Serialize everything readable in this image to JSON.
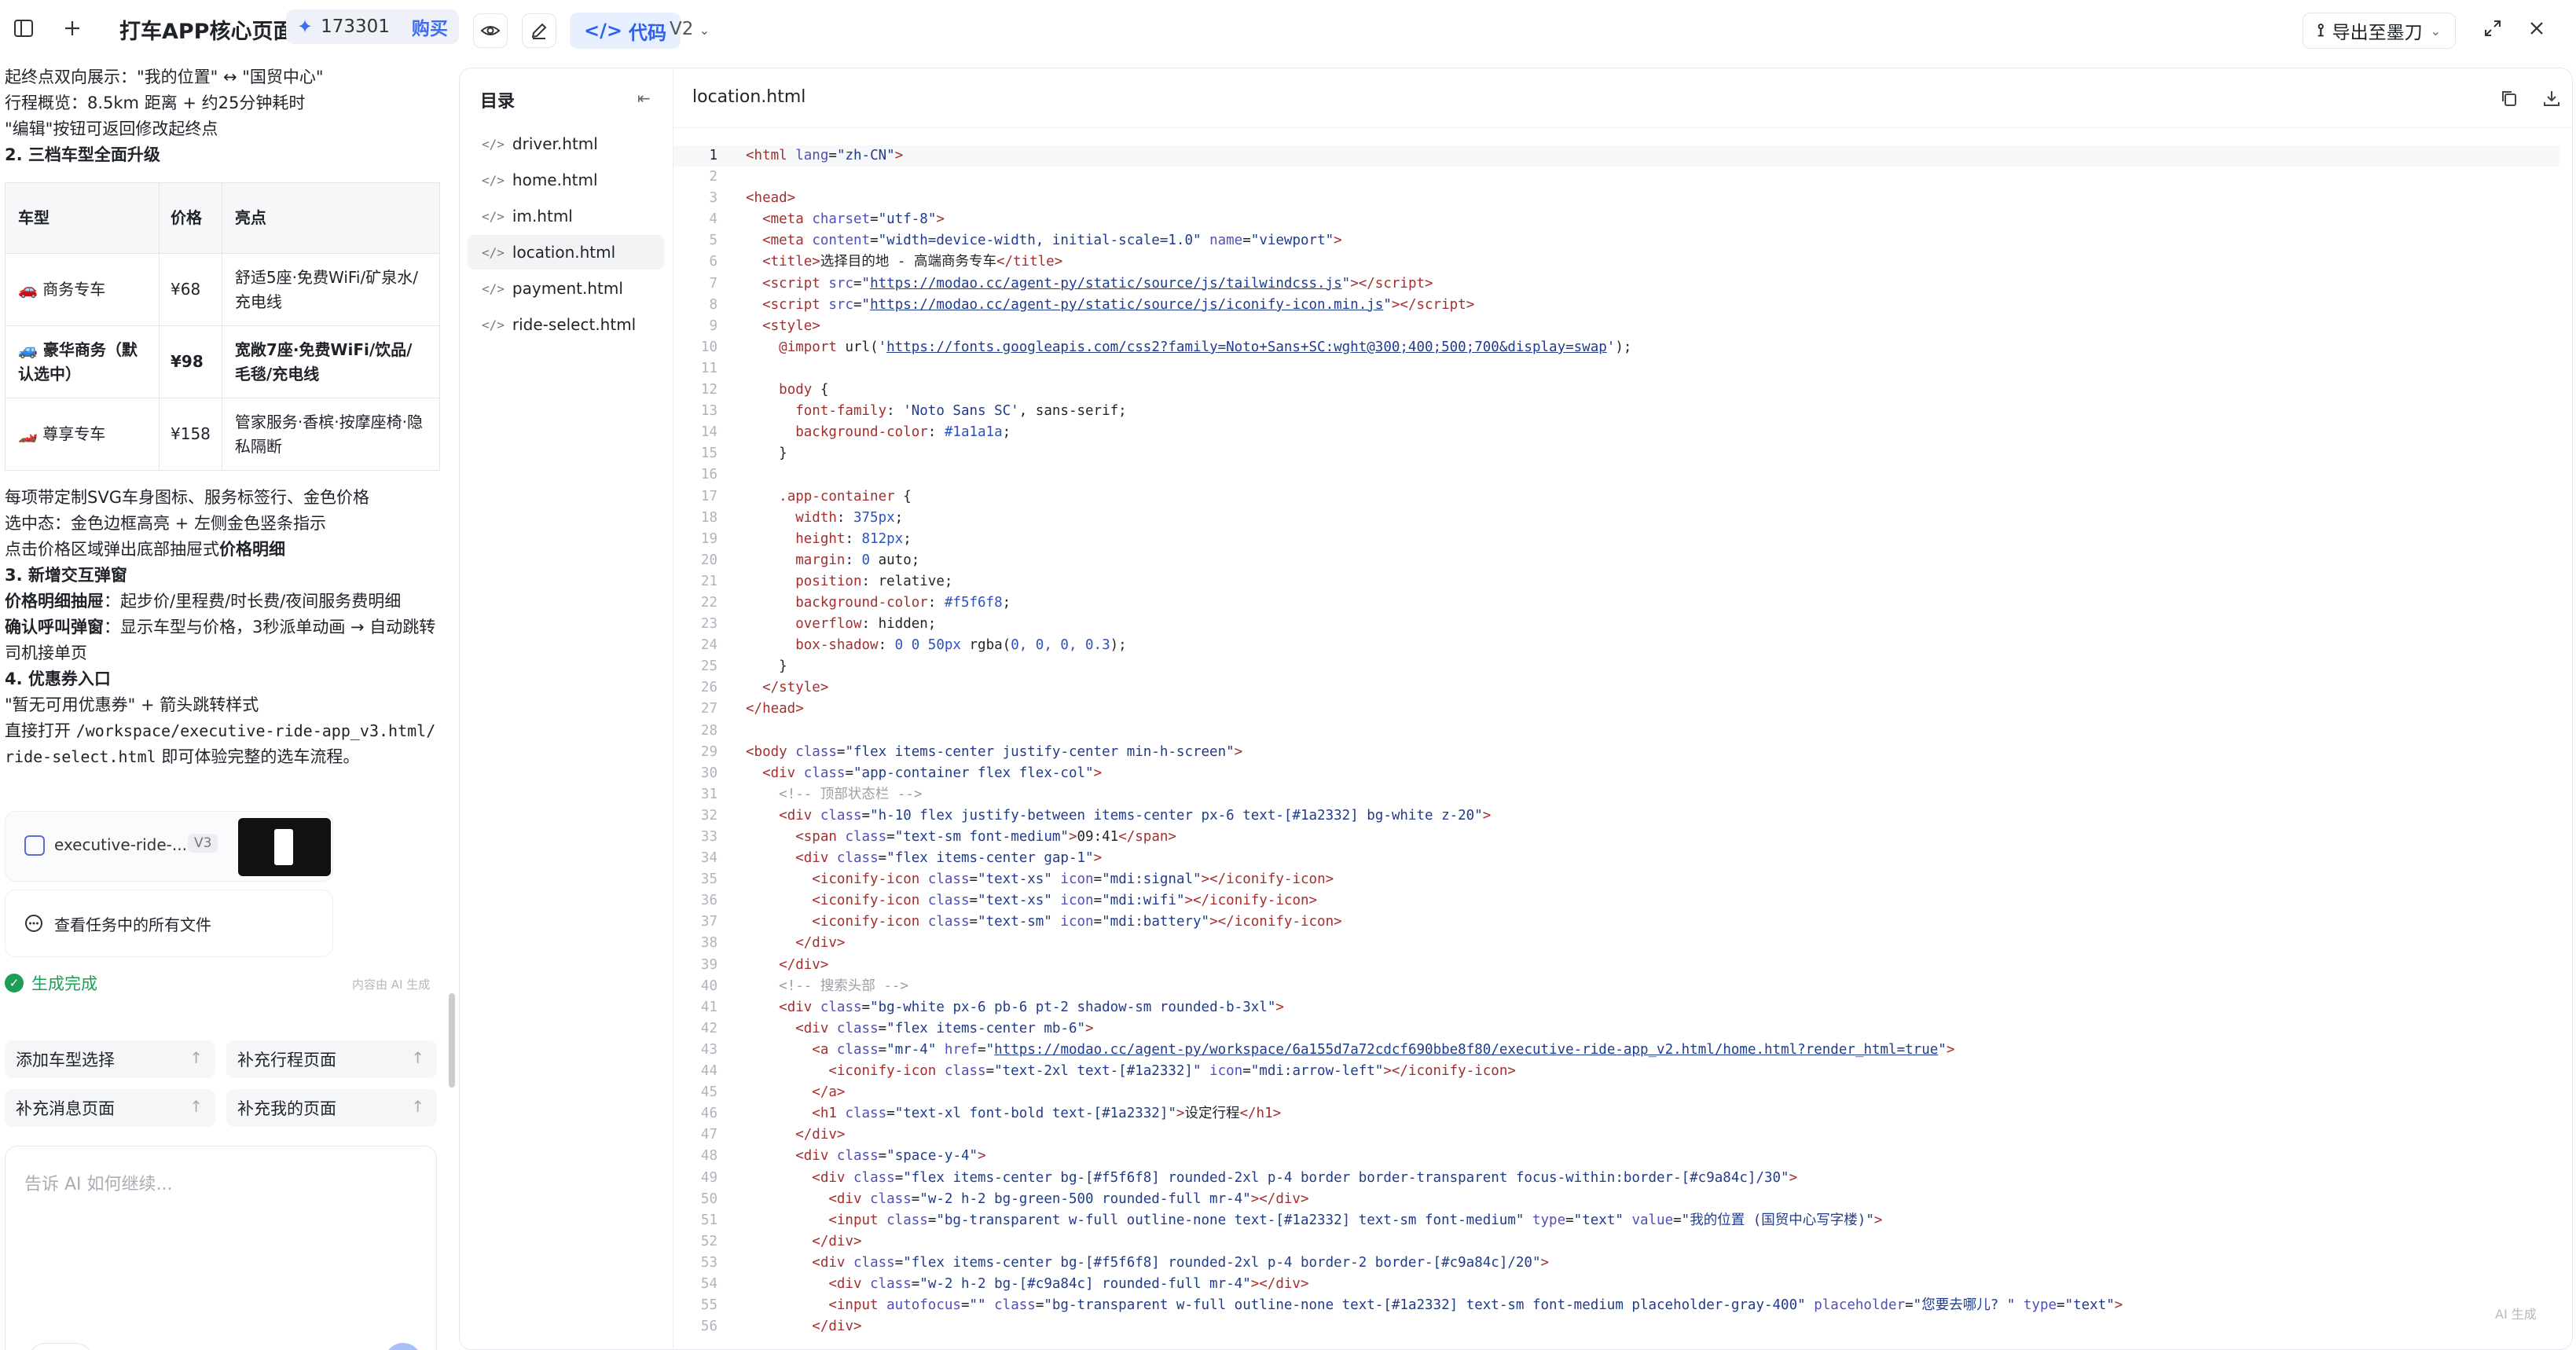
{
  "topbar": {
    "title": "打车APP核心页面...",
    "credits": "173301",
    "buy": "购买",
    "code_tab": "代码",
    "version": "V2",
    "export": "导出至墨刀"
  },
  "chat": {
    "lines_top": [
      "起终点双向展示：\"我的位置\" ↔ \"国贸中心\"",
      "行程概览：8.5km 距离 + 约25分钟耗时",
      "\"编辑\"按钮可返回修改起终点"
    ],
    "h2": "2. 三档车型全面升级",
    "table": {
      "headers": [
        "车型",
        "价格",
        "亮点"
      ],
      "rows": [
        {
          "type": "🚗 商务专车",
          "price": "¥68",
          "highlight": "舒适5座·免费WiFi/矿泉水/充电线"
        },
        {
          "type": "🚙 豪华商务（默认选中）",
          "price": "¥98",
          "highlight": "宽敞7座·免费WiFi/饮品/毛毯/充电线"
        },
        {
          "type": "🏎️ 尊享专车",
          "price": "¥158",
          "highlight": "管家服务·香槟·按摩座椅·隐私隔断"
        }
      ]
    },
    "p1": "每项带定制SVG车身图标、服务标签行、金色价格",
    "p2": "选中态：金色边框高亮 + 左侧金色竖条指示",
    "p3_pre": "点击价格区域弹出底部抽屉式",
    "p3_b": "价格明细",
    "h3": "3. 新增交互弹窗",
    "p4_b": "价格明细抽屉",
    "p4": "：起步价/里程费/时长费/夜间服务费明细",
    "p5_b": "确认呼叫弹窗",
    "p5": "：显示车型与价格，3秒派单动画 → 自动跳转司机接单页",
    "h4": "4. 优惠券入口",
    "p6": "\"暂无可用优惠券\" + 箭头跳转样式",
    "p7_pre": "直接打开 ",
    "p7_code": "/workspace/executive-ride-app_v3.html/ride-select.html",
    "p7_post": " 即可体验完整的选车流程。"
  },
  "filecard": {
    "name": "executive-ride-...",
    "version": "V3"
  },
  "allfiles": "查看任务中的所有文件",
  "status": "生成完成",
  "ai_mark": "内容由 AI 生成",
  "suggestions": [
    "添加车型选择",
    "补充行程页面",
    "补充消息页面",
    "补充我的页面"
  ],
  "input": {
    "placeholder": "告诉 AI 如何继续..."
  },
  "directory": {
    "title": "目录",
    "files": [
      "driver.html",
      "home.html",
      "im.html",
      "location.html",
      "payment.html",
      "ride-select.html"
    ],
    "active": "location.html"
  },
  "editor": {
    "filename": "location.html",
    "ai_mark": "AI 生成",
    "current_line": 1
  },
  "colors": {
    "accent": "#2f62e8",
    "success": "#1e9e55",
    "gold": "#c9a84c"
  }
}
